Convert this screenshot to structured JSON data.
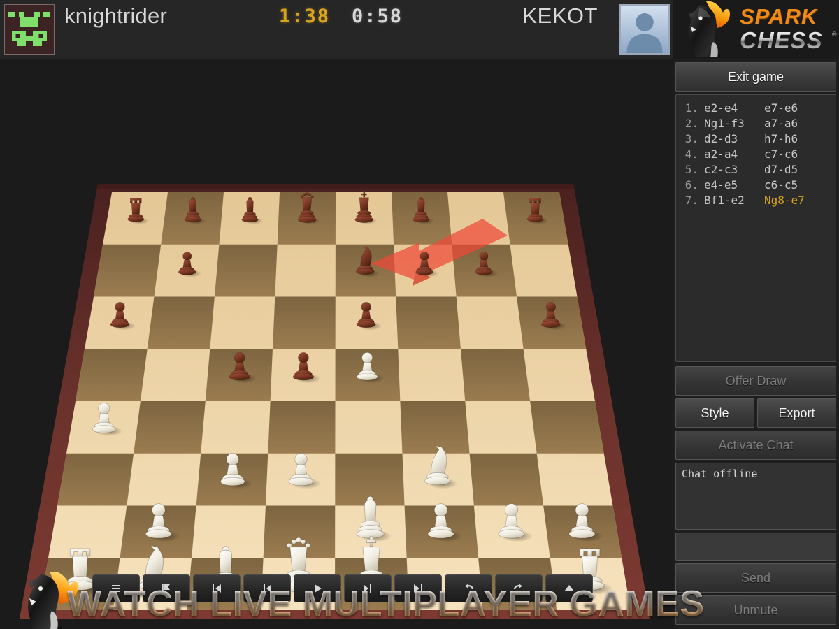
{
  "header": {
    "black_player": {
      "name": "knightrider",
      "avatar_icon": "pixel-invader-avatar",
      "clock": "1:38",
      "clock_active": true,
      "clock_color": "#d9a520"
    },
    "white_player": {
      "name": "KEKOT",
      "avatar_icon": "default-person-avatar",
      "clock": "0:58",
      "clock_active": false,
      "clock_color": "#d7d7d7"
    }
  },
  "logo": {
    "spark": "SPARK",
    "chess": "CHESS",
    "registered": "®",
    "icon": "flaming-knight-logo"
  },
  "side_panel": {
    "exit_button": "Exit game",
    "offer_draw_button": "Offer Draw",
    "style_button": "Style",
    "export_button": "Export",
    "activate_chat_button": "Activate Chat",
    "chat_message": "Chat offline",
    "chat_input_value": "",
    "chat_input_placeholder": "",
    "send_button": "Send",
    "mute_button": "Unmute"
  },
  "moves": [
    {
      "no": "1.",
      "white": "e2-e4",
      "black": "e7-e6",
      "current": false
    },
    {
      "no": "2.",
      "white": "Ng1-f3",
      "black": "a7-a6",
      "current": false
    },
    {
      "no": "3.",
      "white": "d2-d3",
      "black": "h7-h6",
      "current": false
    },
    {
      "no": "4.",
      "white": "a2-a4",
      "black": "c7-c6",
      "current": false
    },
    {
      "no": "5.",
      "white": "c2-c3",
      "black": "d7-d5",
      "current": false
    },
    {
      "no": "6.",
      "white": "e4-e5",
      "black": "c6-c5",
      "current": false
    },
    {
      "no": "7.",
      "white": "Bf1-e2",
      "black": "Ng8-e7",
      "current": true
    }
  ],
  "toolbar": [
    {
      "name": "move-list-icon",
      "glyph": "list"
    },
    {
      "name": "resign-flag-icon",
      "glyph": "flag"
    },
    {
      "name": "first-move-icon",
      "glyph": "first"
    },
    {
      "name": "prev-move-icon",
      "glyph": "prev"
    },
    {
      "name": "play-icon",
      "glyph": "play"
    },
    {
      "name": "next-move-icon",
      "glyph": "next"
    },
    {
      "name": "last-move-icon",
      "glyph": "last"
    },
    {
      "name": "undo-icon",
      "glyph": "undo"
    },
    {
      "name": "redo-icon",
      "glyph": "redo"
    },
    {
      "name": "expand-up-icon",
      "glyph": "up"
    }
  ],
  "banner": {
    "text": "WATCH LIVE MULTIPLAYER GAMES",
    "icon": "flaming-knight-logo"
  },
  "board": {
    "last_move_arrow": {
      "from": "g8",
      "to": "e7",
      "color": "#e8402f"
    },
    "light_square": "#e8cfa0",
    "dark_square": "#8a6f45",
    "frame_color": "#5a2a26",
    "pieces": [
      {
        "square": "a8",
        "piece": "rook",
        "color": "black"
      },
      {
        "square": "b8",
        "piece": "bishop",
        "color": "black"
      },
      {
        "square": "c8",
        "piece": "bishop",
        "color": "black"
      },
      {
        "square": "d8",
        "piece": "queen",
        "color": "black"
      },
      {
        "square": "e8",
        "piece": "king",
        "color": "black"
      },
      {
        "square": "f8",
        "piece": "bishop",
        "color": "black"
      },
      {
        "square": "h8",
        "piece": "rook",
        "color": "black"
      },
      {
        "square": "b7",
        "piece": "pawn",
        "color": "black"
      },
      {
        "square": "e7",
        "piece": "knight",
        "color": "black"
      },
      {
        "square": "f7",
        "piece": "pawn",
        "color": "black"
      },
      {
        "square": "g7",
        "piece": "pawn",
        "color": "black"
      },
      {
        "square": "a6",
        "piece": "pawn",
        "color": "black"
      },
      {
        "square": "e6",
        "piece": "pawn",
        "color": "black"
      },
      {
        "square": "h6",
        "piece": "pawn",
        "color": "black"
      },
      {
        "square": "c5",
        "piece": "pawn",
        "color": "black"
      },
      {
        "square": "d5",
        "piece": "pawn",
        "color": "black"
      },
      {
        "square": "e5",
        "piece": "pawn",
        "color": "white"
      },
      {
        "square": "a4",
        "piece": "pawn",
        "color": "white"
      },
      {
        "square": "c3",
        "piece": "pawn",
        "color": "white"
      },
      {
        "square": "d3",
        "piece": "pawn",
        "color": "white"
      },
      {
        "square": "f3",
        "piece": "knight",
        "color": "white"
      },
      {
        "square": "b2",
        "piece": "pawn",
        "color": "white"
      },
      {
        "square": "e2",
        "piece": "bishop",
        "color": "white"
      },
      {
        "square": "f2",
        "piece": "pawn",
        "color": "white"
      },
      {
        "square": "g2",
        "piece": "pawn",
        "color": "white"
      },
      {
        "square": "h2",
        "piece": "pawn",
        "color": "white"
      },
      {
        "square": "a1",
        "piece": "rook",
        "color": "white"
      },
      {
        "square": "b1",
        "piece": "knight",
        "color": "white"
      },
      {
        "square": "c1",
        "piece": "bishop",
        "color": "white"
      },
      {
        "square": "d1",
        "piece": "queen",
        "color": "white"
      },
      {
        "square": "e1",
        "piece": "king",
        "color": "white"
      },
      {
        "square": "h1",
        "piece": "rook",
        "color": "white"
      }
    ]
  }
}
